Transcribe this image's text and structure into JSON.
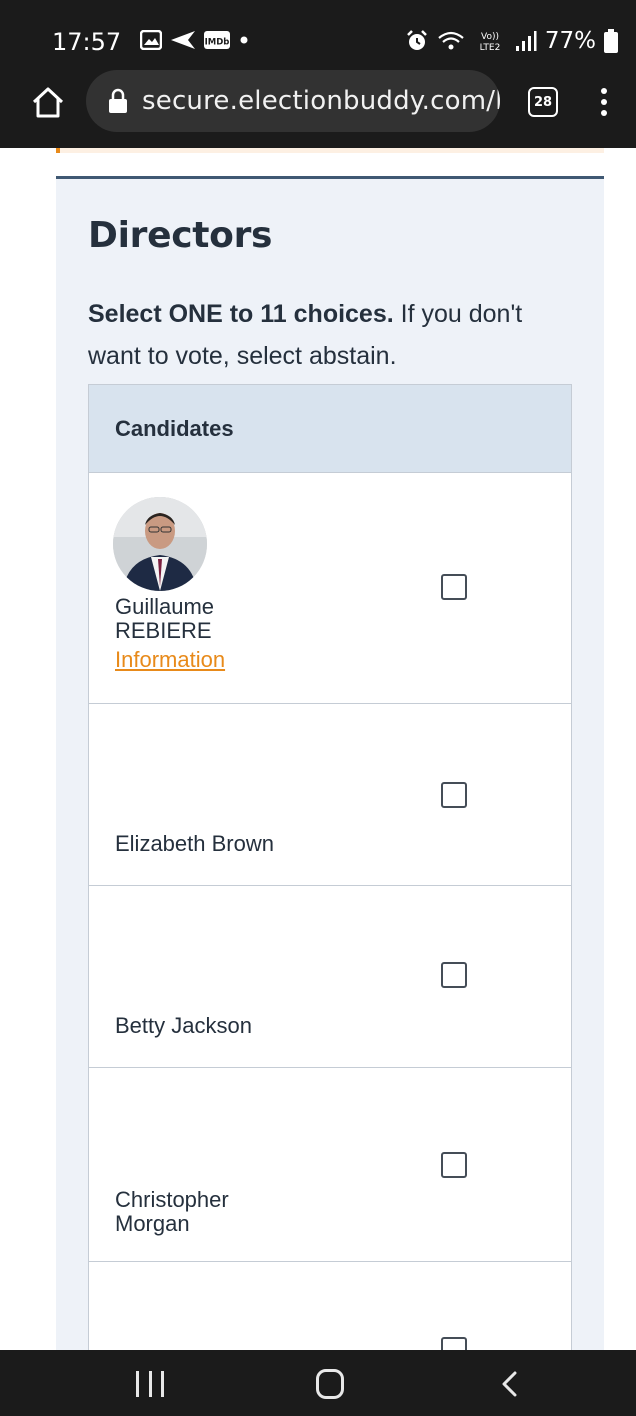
{
  "status_bar": {
    "time": "17:57",
    "left_icons": [
      "gallery-icon",
      "navigation-icon",
      "imdb-icon",
      "dot-icon"
    ],
    "imdb_label": "IMDb",
    "network_label_top": "Vo))",
    "network_label_bottom": "LTE2",
    "battery": "77%"
  },
  "browser": {
    "url": "secure.electionbuddy.com/ba",
    "tab_count": "28"
  },
  "ballot": {
    "question_title": "Directors",
    "instructions_bold": "Select ONE to 11 choices.",
    "instructions_rest": " If you don't want to vote, select abstain.",
    "table_header": "Candidates",
    "candidates": [
      {
        "first": "Guillaume",
        "last": "REBIERE",
        "link": "Information",
        "checked": false
      },
      {
        "name": "Elizabeth Brown",
        "checked": false
      },
      {
        "name": "Betty Jackson",
        "checked": false
      },
      {
        "first": "Christopher",
        "last": "Morgan",
        "checked": false
      },
      {
        "name": "",
        "checked": false
      }
    ]
  },
  "colors": {
    "accent": "#e88a1a",
    "card_background": "#eef2f8",
    "table_header": "#d8e3ee",
    "title_text": "#25303d",
    "bars": "#1b1b1b"
  }
}
